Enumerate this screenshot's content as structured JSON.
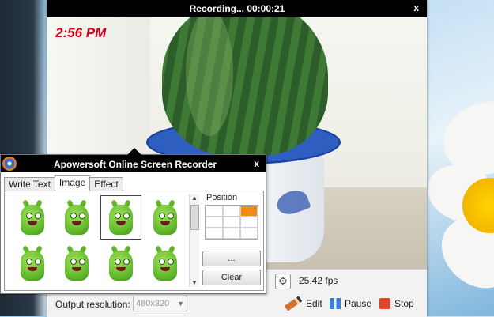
{
  "recorder": {
    "title": "Recording...  00:00:21",
    "close": "x",
    "timestamp": "2:56 PM",
    "fps": "25.42 fps",
    "output_label": "Output resolution:",
    "output_value": "480x320",
    "edit_label": "Edit",
    "pause_label": "Pause",
    "stop_label": "Stop",
    "settings_icon": "⚙"
  },
  "panel": {
    "title": "Apowersoft Online Screen Recorder",
    "close": "x",
    "tabs": [
      "Write Text",
      "Image",
      "Effect"
    ],
    "active_tab": "Image",
    "position_label": "Position",
    "position_selected": "top-right",
    "more_button": "...",
    "clear_button": "Clear",
    "selected_image_index": 2
  },
  "colors": {
    "titlebar": "#000000",
    "timestamp": "#d4001a",
    "position_on": "#f08b1c"
  }
}
